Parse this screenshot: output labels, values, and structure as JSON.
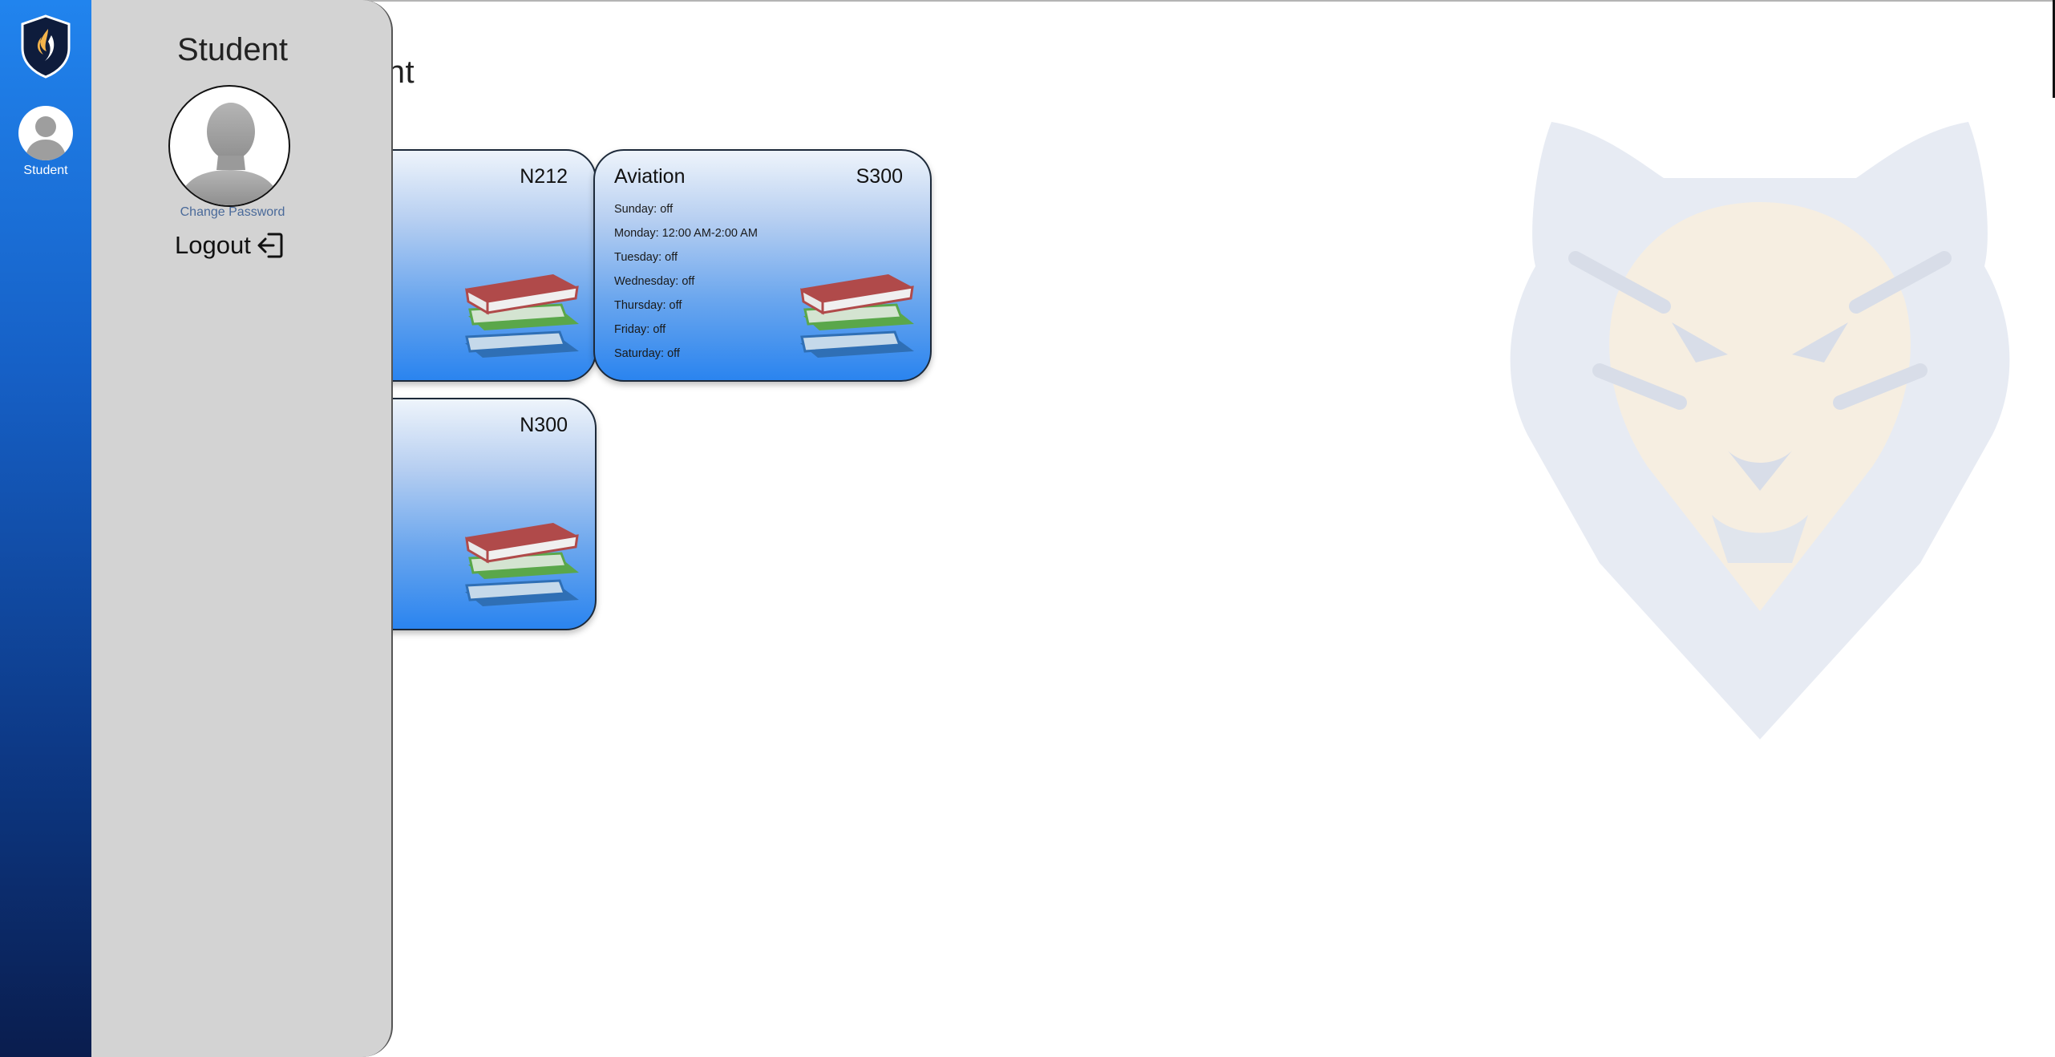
{
  "sidebar": {
    "user_label": "Student"
  },
  "page": {
    "title_fragment": "ent"
  },
  "drawer": {
    "title": "Student",
    "change_password": "Change Password",
    "logout": "Logout"
  },
  "cards": [
    {
      "name": "",
      "room": "N212",
      "schedule": []
    },
    {
      "name": "Aviation",
      "room": "S300",
      "schedule": [
        "Sunday: off",
        "Monday: 12:00 AM-2:00 AM",
        "Tuesday: off",
        "Wednesday: off",
        "Thursday: off",
        "Friday: off",
        "Saturday: off"
      ]
    },
    {
      "name": "",
      "room": "N300",
      "schedule": []
    }
  ],
  "colors": {
    "rail_top": "#2184ee",
    "rail_bottom": "#0a1d4e",
    "drawer_bg": "#d3d3d3",
    "card_bottom": "#2a84ef"
  },
  "icons": [
    "school-logo-icon",
    "avatar-icon",
    "logout-icon",
    "books-icon",
    "tiger-watermark"
  ]
}
